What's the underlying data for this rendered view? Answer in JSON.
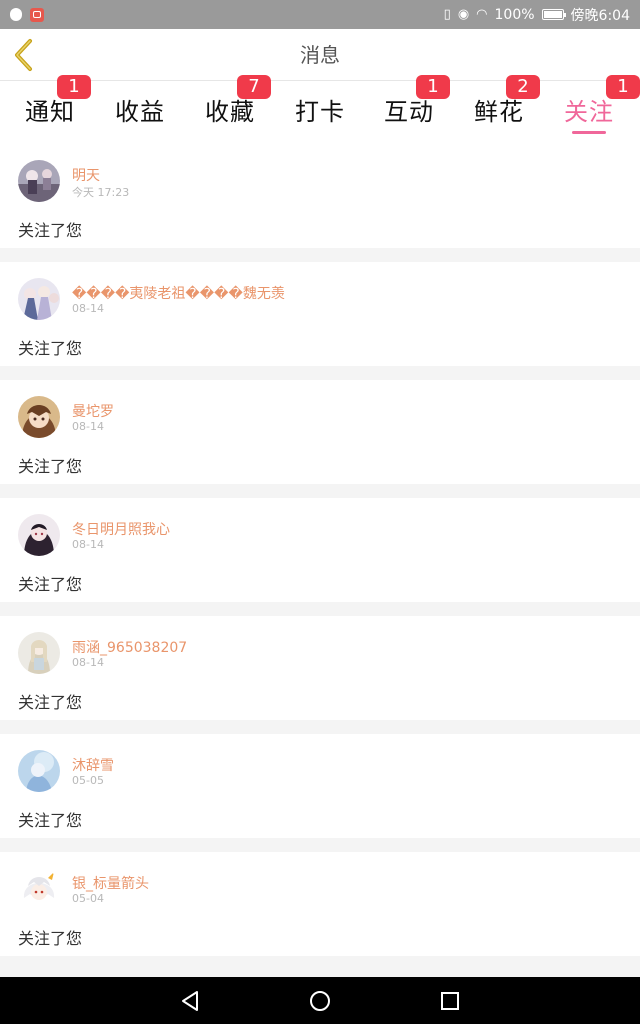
{
  "status_bar": {
    "battery": "100%",
    "time": "傍晚6:04"
  },
  "header": {
    "title": "消息"
  },
  "tabs": [
    {
      "label": "通知",
      "badge": "1"
    },
    {
      "label": "收益",
      "badge": ""
    },
    {
      "label": "收藏",
      "badge": "7"
    },
    {
      "label": "打卡",
      "badge": ""
    },
    {
      "label": "互动",
      "badge": "1"
    },
    {
      "label": "鲜花",
      "badge": "2"
    },
    {
      "label": "关注",
      "badge": "1",
      "active": true
    }
  ],
  "notifications": [
    {
      "name": "明天",
      "time": "今天 17:23",
      "message": "关注了您",
      "avatar": "avatar-1"
    },
    {
      "name": "����夷陵老祖����魏无羡",
      "time": "08-14",
      "message": "关注了您",
      "avatar": "avatar-2"
    },
    {
      "name": "曼坨罗",
      "time": "08-14",
      "message": "关注了您",
      "avatar": "avatar-3"
    },
    {
      "name": "冬日明月照我心",
      "time": "08-14",
      "message": "关注了您",
      "avatar": "avatar-4"
    },
    {
      "name": "雨涵_965038207",
      "time": "08-14",
      "message": "关注了您",
      "avatar": "avatar-5"
    },
    {
      "name": "沐辞雪",
      "time": "05-05",
      "message": "关注了您",
      "avatar": "avatar-6"
    },
    {
      "name": "银_标量箭头",
      "time": "05-04",
      "message": "关注了您",
      "avatar": "avatar-7"
    }
  ],
  "colors": {
    "accent": "#f0679a",
    "badge": "#f03a4a",
    "username": "#e9956b",
    "back_arrow": "#c7a21a"
  },
  "icons": {
    "back": "chevron-left-icon",
    "nav_back": "triangle-back-icon",
    "nav_home": "circle-home-icon",
    "nav_recent": "square-recent-icon"
  }
}
